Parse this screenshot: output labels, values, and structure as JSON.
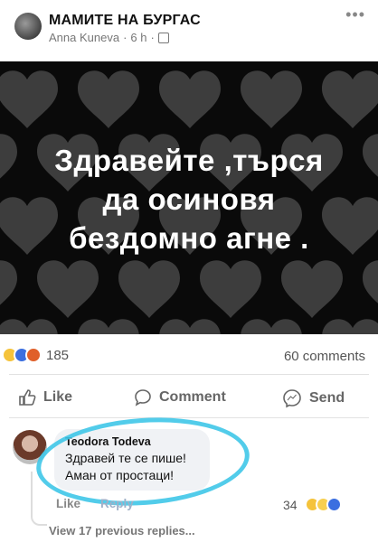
{
  "post": {
    "group_name": "МАМИТЕ НА БУРГАС",
    "author": "Anna Kuneva",
    "time": "6 h",
    "separator": "·",
    "more": "•••",
    "image_text_lines": [
      "Здравейте ,търся",
      "да осиновя",
      "бездомно агне ."
    ]
  },
  "stats": {
    "reaction_count": "185",
    "comments": "60 comments"
  },
  "actions": {
    "like": "Like",
    "comment": "Comment",
    "send": "Send"
  },
  "comment": {
    "name": "Teodora Todeva",
    "line1": "Здравей те се пише!",
    "line2": "Аман от простаци!",
    "like": "Like",
    "reply": "Reply",
    "reaction_count": "34"
  },
  "view_previous": "View 17 previous replies...",
  "colors": {
    "highlight": "#3fc6e8",
    "like_blue": "#3b6fe0",
    "haha_yellow": "#f5c33b",
    "angry_orange": "#e0602a"
  },
  "icons": [
    "more-icon",
    "globe-icon",
    "like-thumb-icon",
    "comment-bubble-icon",
    "messenger-icon"
  ]
}
